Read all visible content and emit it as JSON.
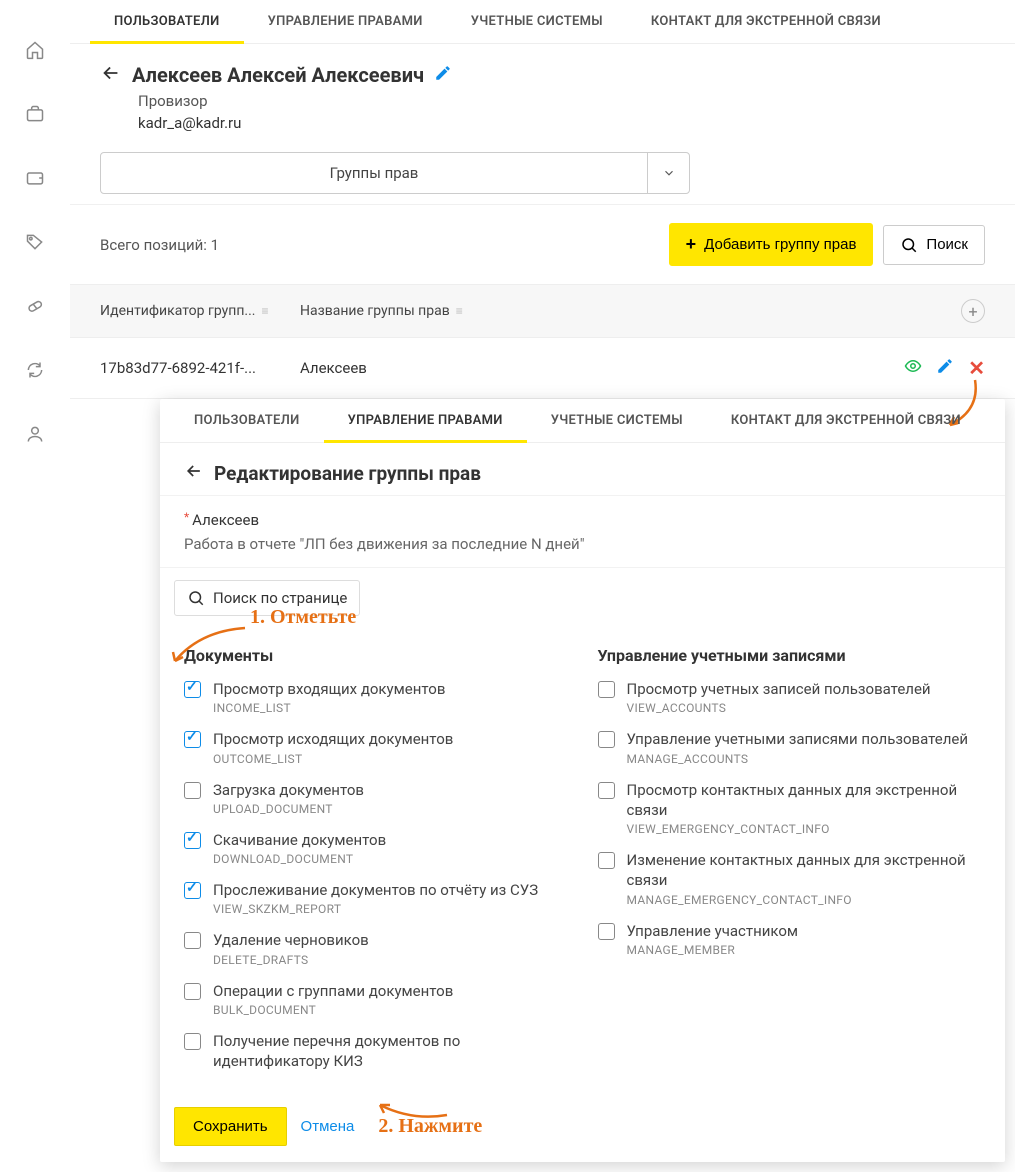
{
  "tabs": [
    "ПОЛЬЗОВАТЕЛИ",
    "УПРАВЛЕНИЕ ПРАВАМИ",
    "УЧЕТНЫЕ СИСТЕМЫ",
    "КОНТАКТ ДЛЯ ЭКСТРЕННОЙ СВЯЗИ"
  ],
  "user": {
    "name": "Алексеев Алексей Алексеевич",
    "role": "Провизор",
    "email": "kadr_a@kadr.ru"
  },
  "dropdown": {
    "label": "Группы прав"
  },
  "toolbar": {
    "total": "Всего позиций: 1",
    "add": "Добавить группу прав",
    "search": "Поиск"
  },
  "table": {
    "headers": [
      "Идентификатор групп...",
      "Название группы прав"
    ],
    "row": {
      "id": "17b83d77-6892-421f-...",
      "name": "Алексеев"
    }
  },
  "modal": {
    "tabs": [
      "ПОЛЬЗОВАТЕЛИ",
      "УПРАВЛЕНИЕ ПРАВАМИ",
      "УЧЕТНЫЕ СИСТЕМЫ",
      "КОНТАКТ ДЛЯ ЭКСТРЕННОЙ СВЯЗИ"
    ],
    "title": "Редактирование группы прав",
    "name": "Алексеев",
    "description": "Работа в отчете \"ЛП без движения за последние N дней\"",
    "search_placeholder": "Поиск по странице",
    "col1_heading": "Документы",
    "col2_heading": "Управление учетными записями",
    "col1": [
      {
        "label": "Просмотр входящих документов",
        "code": "INCOME_LIST",
        "checked": true
      },
      {
        "label": "Просмотр исходящих документов",
        "code": "OUTCOME_LIST",
        "checked": true
      },
      {
        "label": "Загрузка документов",
        "code": "UPLOAD_DOCUMENT",
        "checked": false
      },
      {
        "label": "Скачивание документов",
        "code": "DOWNLOAD_DOCUMENT",
        "checked": true
      },
      {
        "label": "Прослеживание документов по отчёту из СУЗ",
        "code": "VIEW_SKZKM_REPORT",
        "checked": true
      },
      {
        "label": "Удаление черновиков",
        "code": "DELETE_DRAFTS",
        "checked": false
      },
      {
        "label": "Операции с группами документов",
        "code": "BULK_DOCUMENT",
        "checked": false
      },
      {
        "label": "Получение перечня документов по идентификатору КИЗ",
        "code": "",
        "checked": false
      }
    ],
    "col2": [
      {
        "label": "Просмотр учетных записей пользователей",
        "code": "VIEW_ACCOUNTS",
        "checked": false
      },
      {
        "label": "Управление учетными записями пользователей",
        "code": "MANAGE_ACCOUNTS",
        "checked": false
      },
      {
        "label": "Просмотр контактных данных для экстренной связи",
        "code": "VIEW_EMERGENCY_CONTACT_INFO",
        "checked": false
      },
      {
        "label": "Изменение контактных данных для экстренной связи",
        "code": "MANAGE_EMERGENCY_CONTACT_INFO",
        "checked": false
      },
      {
        "label": "Управление участником",
        "code": "MANAGE_MEMBER",
        "checked": false
      }
    ],
    "save": "Сохранить",
    "cancel": "Отмена"
  },
  "annotations": {
    "step1": "1. Отметьте",
    "step2": "2. Нажмите"
  }
}
